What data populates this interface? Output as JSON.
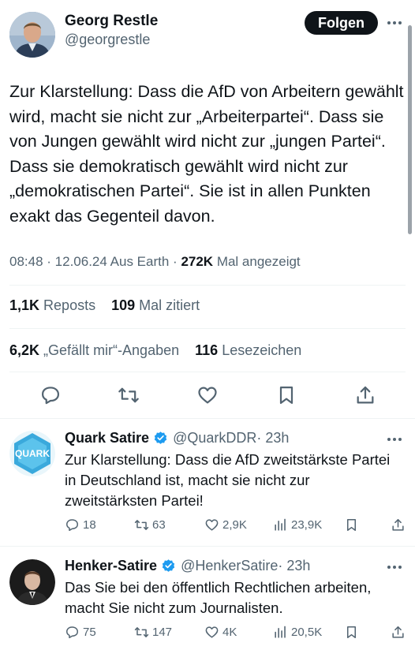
{
  "main_tweet": {
    "author_name": "Georg Restle",
    "author_handle": "@georgrestle",
    "follow_label": "Folgen",
    "text": "Zur Klarstellung: Dass die AfD von Arbeitern gewählt wird, macht sie nicht zur „Arbeiterpartei“. Dass sie von Jungen gewählt wird nicht zur „jungen Partei“. Dass sie demokratisch gewählt wird nicht zur „demokratischen Partei“.  Sie ist in allen Punkten exakt das Gegenteil davon.",
    "time": "08:48",
    "date": "12.06.24",
    "source": "Aus Earth",
    "views_count": "272K",
    "views_label": "Mal angezeigt",
    "reposts_count": "1,1K",
    "reposts_label": "Reposts",
    "quotes_count": "109",
    "quotes_label": "Mal zitiert",
    "likes_count": "6,2K",
    "likes_label": "„Gefällt mir“-Angaben",
    "bookmarks_count": "116",
    "bookmarks_label": "Lesezeichen"
  },
  "replies": [
    {
      "name": "Quark Satire",
      "handle": "@QuarkDDR",
      "time": "· 23h",
      "avatar_text": "QUARK",
      "text": "Zur Klarstellung: Dass die AfD zweitstärkste Partei in Deutschland ist, macht sie nicht zur zweitstärksten Partei!",
      "replies": "18",
      "reposts": "63",
      "likes": "2,9K",
      "views": "23,9K"
    },
    {
      "name": "Henker-Satire",
      "handle": "@HenkerSatire",
      "time": "· 23h",
      "text": "Das Sie bei den öffentlich Rechtlichen arbeiten, macht Sie nicht zum Journalisten.",
      "replies": "75",
      "reposts": "147",
      "likes": "4K",
      "views": "20,5K"
    }
  ],
  "icons": [
    "reply-icon",
    "repost-icon",
    "like-icon",
    "bookmark-icon",
    "share-icon",
    "views-icon",
    "verified-icon",
    "more-icon"
  ],
  "colors": {
    "accent": "#1d9bf0",
    "text": "#0f1419",
    "secondary": "#536471",
    "verified": "#1d9bf0"
  }
}
